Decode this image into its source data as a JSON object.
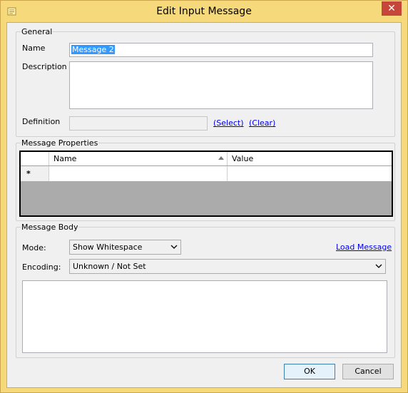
{
  "window": {
    "title": "Edit Input Message",
    "close_glyph": "✕",
    "frame_color": "#f5d97a"
  },
  "general": {
    "legend": "General",
    "name_label": "Name",
    "name_value": "Message 2",
    "description_label": "Description",
    "description_value": "",
    "definition_label": "Definition",
    "definition_value": "",
    "select_link": "(Select)",
    "clear_link": "(Clear)"
  },
  "properties": {
    "legend": "Message Properties",
    "columns": [
      "Name",
      "Value"
    ],
    "new_row_marker": "*"
  },
  "body": {
    "legend": "Message Body",
    "mode_label": "Mode:",
    "mode_value": "Show Whitespace",
    "load_link": "Load Message",
    "encoding_label": "Encoding:",
    "encoding_value": "Unknown / Not Set",
    "content": ""
  },
  "buttons": {
    "ok": "OK",
    "cancel": "Cancel"
  },
  "icons": {
    "app": "note-icon",
    "close": "close-icon",
    "sort": "sort-ascending-icon",
    "dropdown": "chevron-down-icon"
  }
}
